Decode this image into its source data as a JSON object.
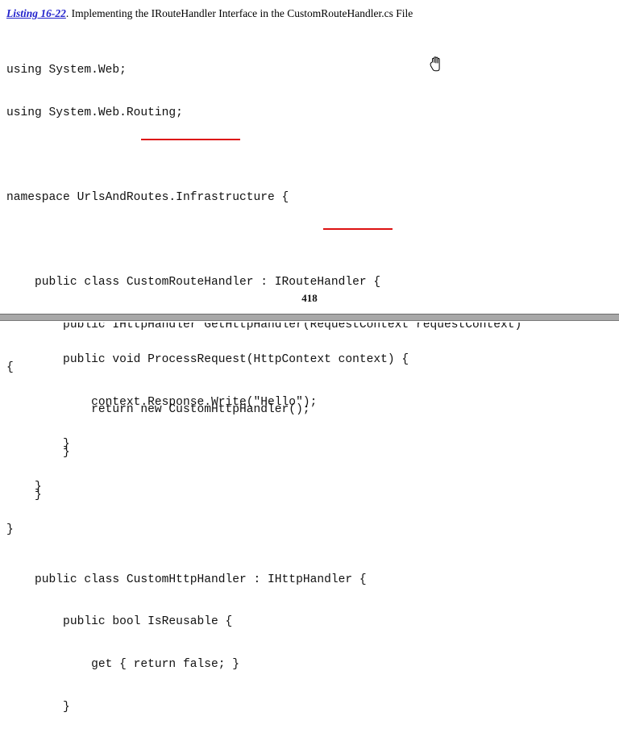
{
  "document": {
    "background_color": "#ffffff",
    "text_color": "#000000"
  },
  "caption": {
    "listing_ref": "Listing 16-22",
    "period": ".",
    "text": "  Implementing the IRouteHandler Interface in the CustomRouteHandler.cs File",
    "ref_color": "#2222cc"
  },
  "code_top": {
    "lines": [
      "using System.Web;",
      "using System.Web.Routing;",
      "",
      "namespace UrlsAndRoutes.Infrastructure {",
      "",
      "    public class CustomRouteHandler : IRouteHandler {",
      "        public IHttpHandler GetHttpHandler(RequestContext requestContext)",
      "{",
      "            return new CustomHttpHandler();",
      "        }",
      "    }",
      "",
      "    public class CustomHttpHandler : IHttpHandler {",
      "        public bool IsReusable {",
      "            get { return false; }",
      "        }"
    ]
  },
  "code_bottom": {
    "lines": [
      "        public void ProcessRequest(HttpContext context) {",
      "            context.Response.Write(\"Hello\");",
      "        }",
      "    }",
      "}"
    ]
  },
  "annotations": {
    "color": "#dd1111",
    "underline_1_target": "IHttpHandler",
    "underline_2_target": "IHttpHandler"
  },
  "page_break": {
    "page_number": "418",
    "band_color": "#a8a8a8",
    "line_color": "#6e6e6e"
  },
  "cursor": {
    "icon": "open-hand-cursor"
  }
}
